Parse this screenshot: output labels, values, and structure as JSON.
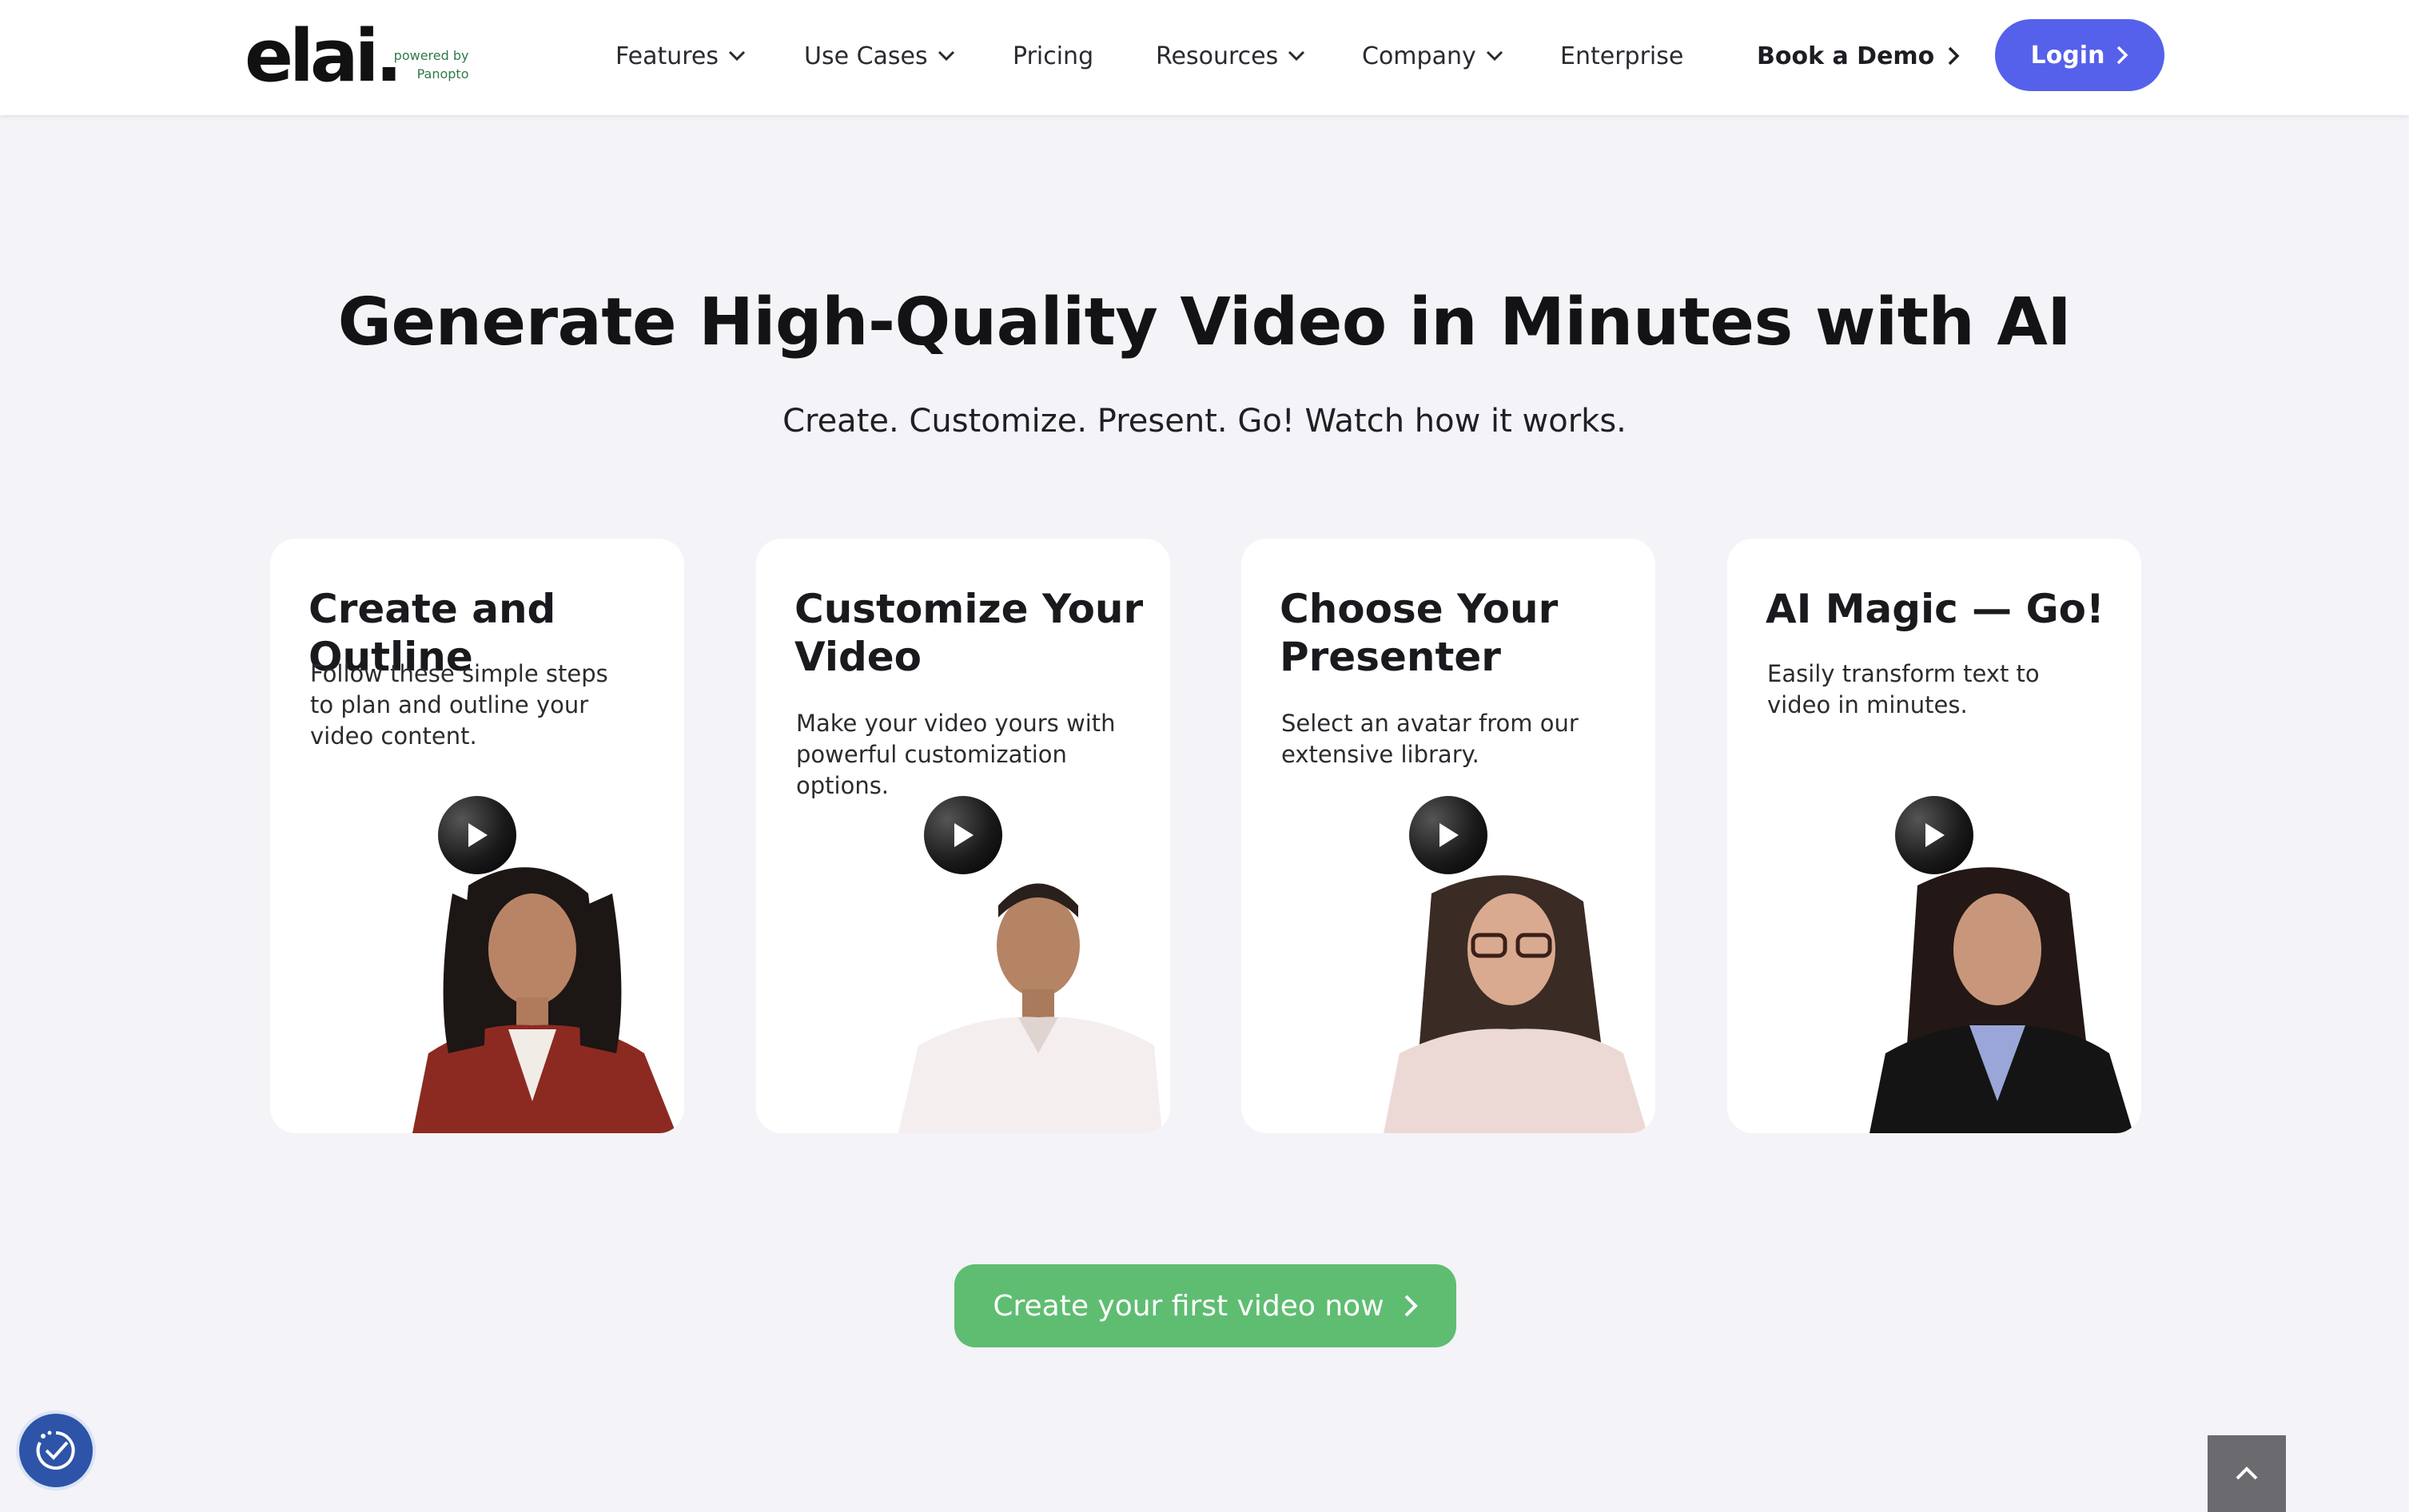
{
  "header": {
    "logo": {
      "brand": "elai.",
      "powered_line1": "powered by",
      "powered_line2": "Panopto"
    },
    "nav": [
      {
        "label": "Features",
        "has_dropdown": true
      },
      {
        "label": "Use Cases",
        "has_dropdown": true
      },
      {
        "label": "Pricing",
        "has_dropdown": false
      },
      {
        "label": "Resources",
        "has_dropdown": true
      },
      {
        "label": "Company",
        "has_dropdown": true
      },
      {
        "label": "Enterprise",
        "has_dropdown": false
      }
    ],
    "book_demo": "Book a Demo",
    "login": "Login"
  },
  "hero": {
    "title": "Generate High-Quality Video in Minutes with AI",
    "subtitle": "Create. Customize. Present. Go! Watch how it works."
  },
  "cards": [
    {
      "title": "Create and Outline",
      "description": "Follow these simple steps to plan and outline your video content.",
      "avatar": "woman-red-cardigan"
    },
    {
      "title": "Customize Your Video",
      "description": "Make your video yours with powerful customization options.",
      "avatar": "man-white-shirt"
    },
    {
      "title": "Choose Your Presenter",
      "description": "Select an avatar from our extensive library.",
      "avatar": "woman-glasses"
    },
    {
      "title": "AI Magic — Go!",
      "description": "Easily transform text to video in minutes.",
      "avatar": "woman-black-blazer"
    }
  ],
  "cta": {
    "label": "Create your first video now"
  },
  "colors": {
    "page_bg": "#f4f3f8",
    "login_bg": "#5561ea",
    "cta_bg": "#5fbd72",
    "brand_green": "#2f7a4a",
    "accessibility_bg": "#2d54a8",
    "scroll_top_bg": "#6b6b6f"
  },
  "icons": {
    "dropdown": "chevron-down-icon",
    "arrow": "chevron-right-icon",
    "play": "play-icon",
    "accessibility": "accessibility-icon",
    "scroll_top": "chevron-up-icon"
  }
}
